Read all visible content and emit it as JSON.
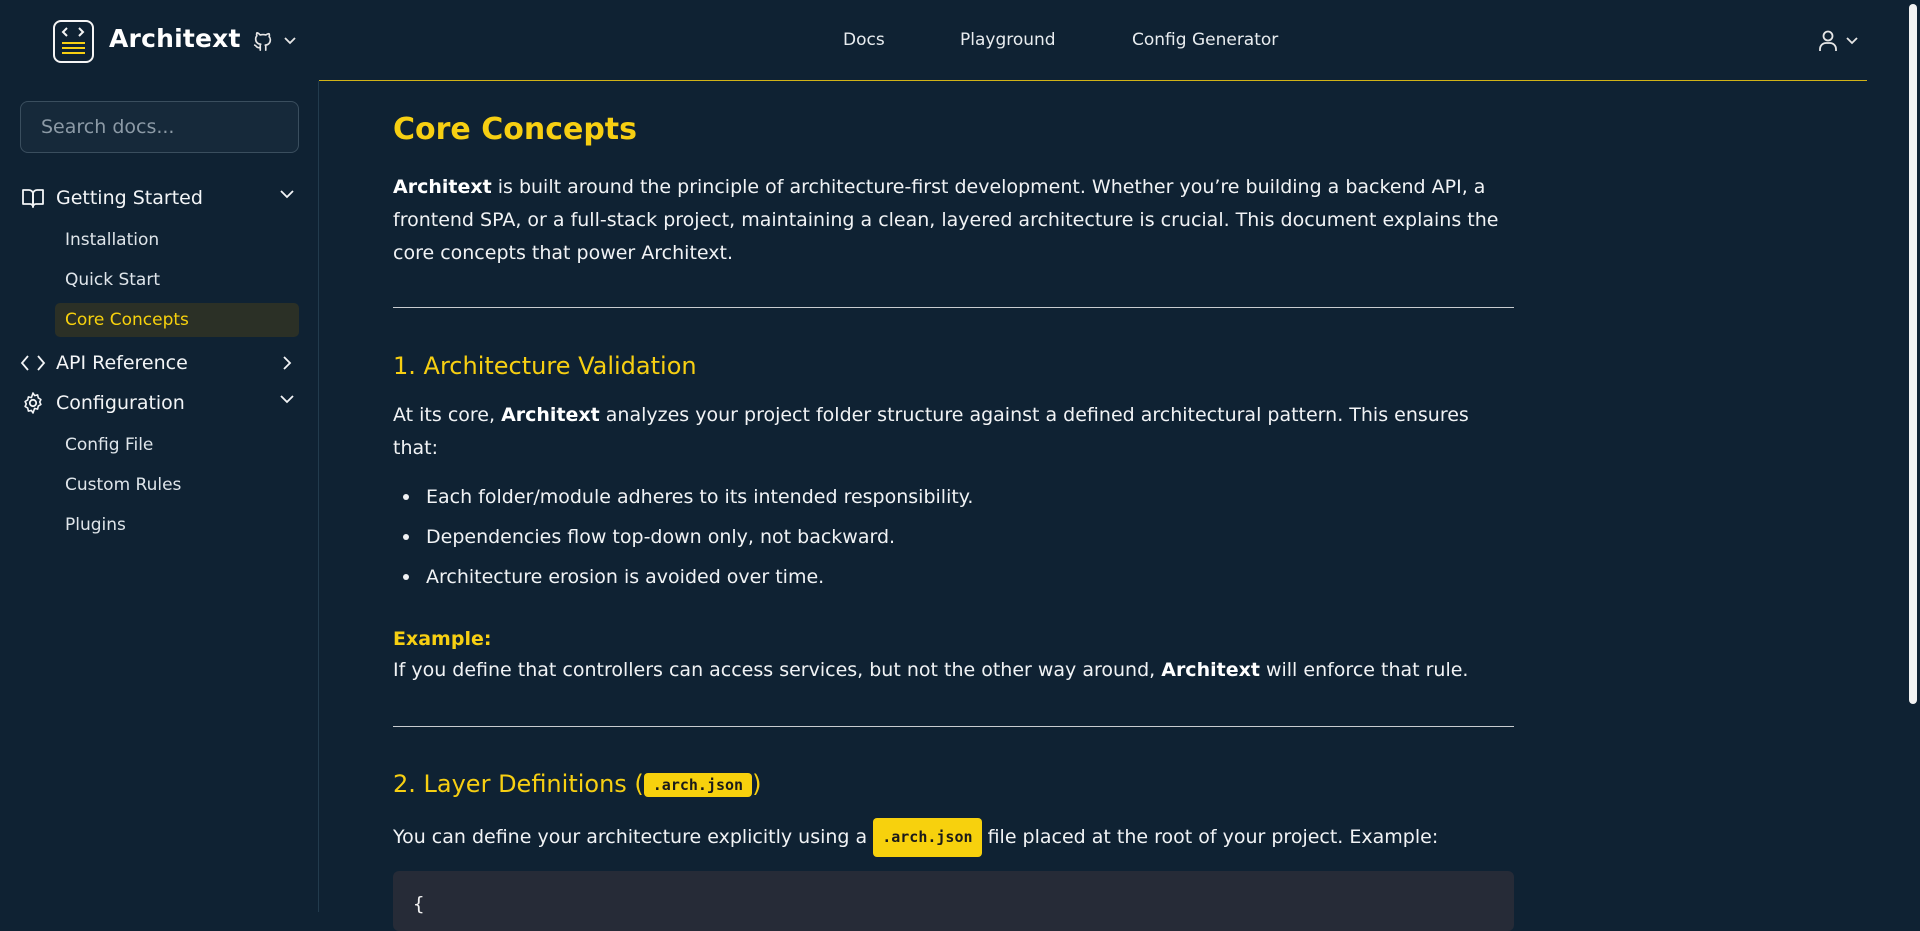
{
  "header": {
    "brand": "Architext",
    "nav": [
      "Docs",
      "Playground",
      "Config Generator"
    ]
  },
  "sidebar": {
    "search_placeholder": "Search docs...",
    "groups": [
      {
        "label": "Getting Started",
        "icon": "book-open-icon",
        "expanded": true,
        "items": [
          "Installation",
          "Quick Start",
          "Core Concepts"
        ]
      },
      {
        "label": "API Reference",
        "icon": "code-icon",
        "expanded": false,
        "items": []
      },
      {
        "label": "Configuration",
        "icon": "gear-icon",
        "expanded": true,
        "items": [
          "Config File",
          "Custom Rules",
          "Plugins"
        ]
      }
    ],
    "active_item": "Core Concepts"
  },
  "content": {
    "title": "Core Concepts",
    "intro": {
      "bold": "Architext",
      "line1": " is built around the principle of architecture-first development. Whether you’re building a backend API, a",
      "line2": "frontend SPA, or a full-stack project, maintaining a clean, layered architecture is crucial. This document explains the",
      "line3": "core concepts that power Architext."
    },
    "section1": {
      "heading": "1. Architecture Validation",
      "p_start": "At its core, ",
      "p_bold": "Architext",
      "p_end": " analyzes your project folder structure against a defined architectural pattern. This ensures",
      "p_line2": "that:",
      "bullets": [
        "Each folder/module adheres to its intended responsibility.",
        "Dependencies flow top-down only, not backward.",
        "Architecture erosion is avoided over time."
      ],
      "example_label": "Example:",
      "example_start": "If you define that controllers can access services, but not the other way around, ",
      "example_bold": "Architext",
      "example_end": " will enforce that rule."
    },
    "section2": {
      "heading_start": "2. Layer Definitions (",
      "heading_code": ".arch.json",
      "heading_end": ")",
      "p_start": "You can define your architecture explicitly using a ",
      "p_code": ".arch.json",
      "p_end": " file placed at the root of your project. Example:",
      "code_first_line": "{"
    }
  },
  "colors": {
    "background": "#0f2233",
    "accent": "#f7cf12",
    "text": "#f1f3f5",
    "active_bg": "#2b3026",
    "code_bg": "#262b37"
  }
}
